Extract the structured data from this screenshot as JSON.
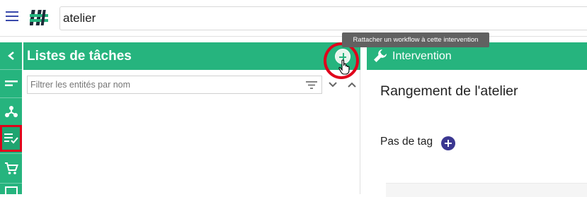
{
  "header": {
    "search_value": "atelier"
  },
  "tooltip": {
    "text": "Rattacher un workflow à cette intervention"
  },
  "left_panel": {
    "title": "Listes de tâches",
    "filter_placeholder": "Filtrer les entités par nom"
  },
  "right_panel": {
    "title": "Intervention",
    "intervention_name": "Rangement de l'atelier",
    "tag_label": "Pas de tag"
  },
  "sidebar": {
    "items": [
      {
        "icon": "chevron-left-icon"
      },
      {
        "icon": "short-text-icon"
      },
      {
        "icon": "hub-icon"
      },
      {
        "icon": "playlist-check-icon",
        "active": true
      },
      {
        "icon": "cart-icon"
      }
    ]
  },
  "colors": {
    "primary_green": "#26b47e",
    "accent_indigo": "#3949ab",
    "tag_button": "#3b3791",
    "highlight_red": "#e0001b"
  }
}
